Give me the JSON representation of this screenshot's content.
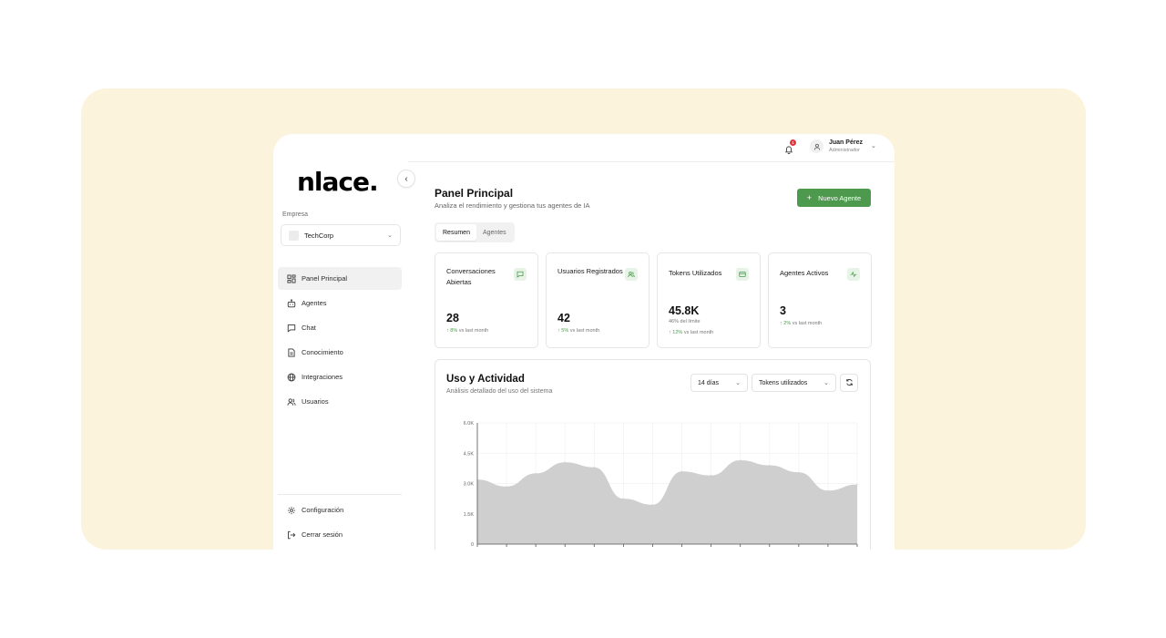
{
  "brand": {
    "logo_text": "nlace."
  },
  "sidebar": {
    "company_label": "Empresa",
    "company_name": "TechCorp",
    "items": [
      {
        "label": "Panel Principal",
        "icon": "layout-grid-icon",
        "active": true
      },
      {
        "label": "Agentes",
        "icon": "bot-icon",
        "active": false
      },
      {
        "label": "Chat",
        "icon": "chat-icon",
        "active": false
      },
      {
        "label": "Conocimiento",
        "icon": "document-icon",
        "active": false
      },
      {
        "label": "Integraciones",
        "icon": "globe-icon",
        "active": false
      },
      {
        "label": "Usuarios",
        "icon": "users-icon",
        "active": false
      }
    ],
    "bottom_items": [
      {
        "label": "Configuración",
        "icon": "gear-icon"
      },
      {
        "label": "Cerrar sesión",
        "icon": "logout-icon"
      }
    ]
  },
  "topbar": {
    "notification_count": "1",
    "user_name": "Juan Pérez",
    "user_role": "Administrador"
  },
  "header": {
    "title": "Panel Principal",
    "subtitle": "Analiza el rendimiento y gestiona tus agentes de IA",
    "new_agent_label": "Nuevo Agente"
  },
  "tabs": [
    {
      "label": "Resumen",
      "active": true
    },
    {
      "label": "Agentes",
      "active": false
    }
  ],
  "stats": [
    {
      "title": "Conversaciones Abiertas",
      "value": "28",
      "note": "",
      "change_value": "8%",
      "change_text": "vs last month",
      "icon": "message-icon"
    },
    {
      "title": "Usuarios Registrados",
      "value": "42",
      "note": "",
      "change_value": "5%",
      "change_text": "vs last month",
      "icon": "users-icon"
    },
    {
      "title": "Tokens Utilizados",
      "value": "45.8K",
      "note": "46% del límite",
      "change_value": "12%",
      "change_text": "vs last month",
      "icon": "credit-card-icon"
    },
    {
      "title": "Agentes Activos",
      "value": "3",
      "note": "",
      "change_value": "2%",
      "change_text": "vs last month",
      "icon": "activity-icon"
    }
  ],
  "usage": {
    "title": "Uso y Actividad",
    "subtitle": "Análisis detallado del uso del sistema",
    "range_value": "14 días",
    "metric_value": "Tokens utilizados"
  },
  "colors": {
    "accent": "#4d9a4f",
    "backdrop": "#fcf3dd",
    "area_fill": "#cfcfcf",
    "badge": "#e0383e"
  },
  "chart_data": {
    "type": "area",
    "yticks": [
      "6.0K",
      "4.5K",
      "3.0K",
      "1.5K",
      "0"
    ],
    "ylim": [
      0,
      6000
    ],
    "values": [
      3200,
      2850,
      3500,
      4050,
      3800,
      2250,
      1950,
      3600,
      3400,
      4150,
      3900,
      3550,
      2650,
      2950
    ],
    "grid": true
  }
}
